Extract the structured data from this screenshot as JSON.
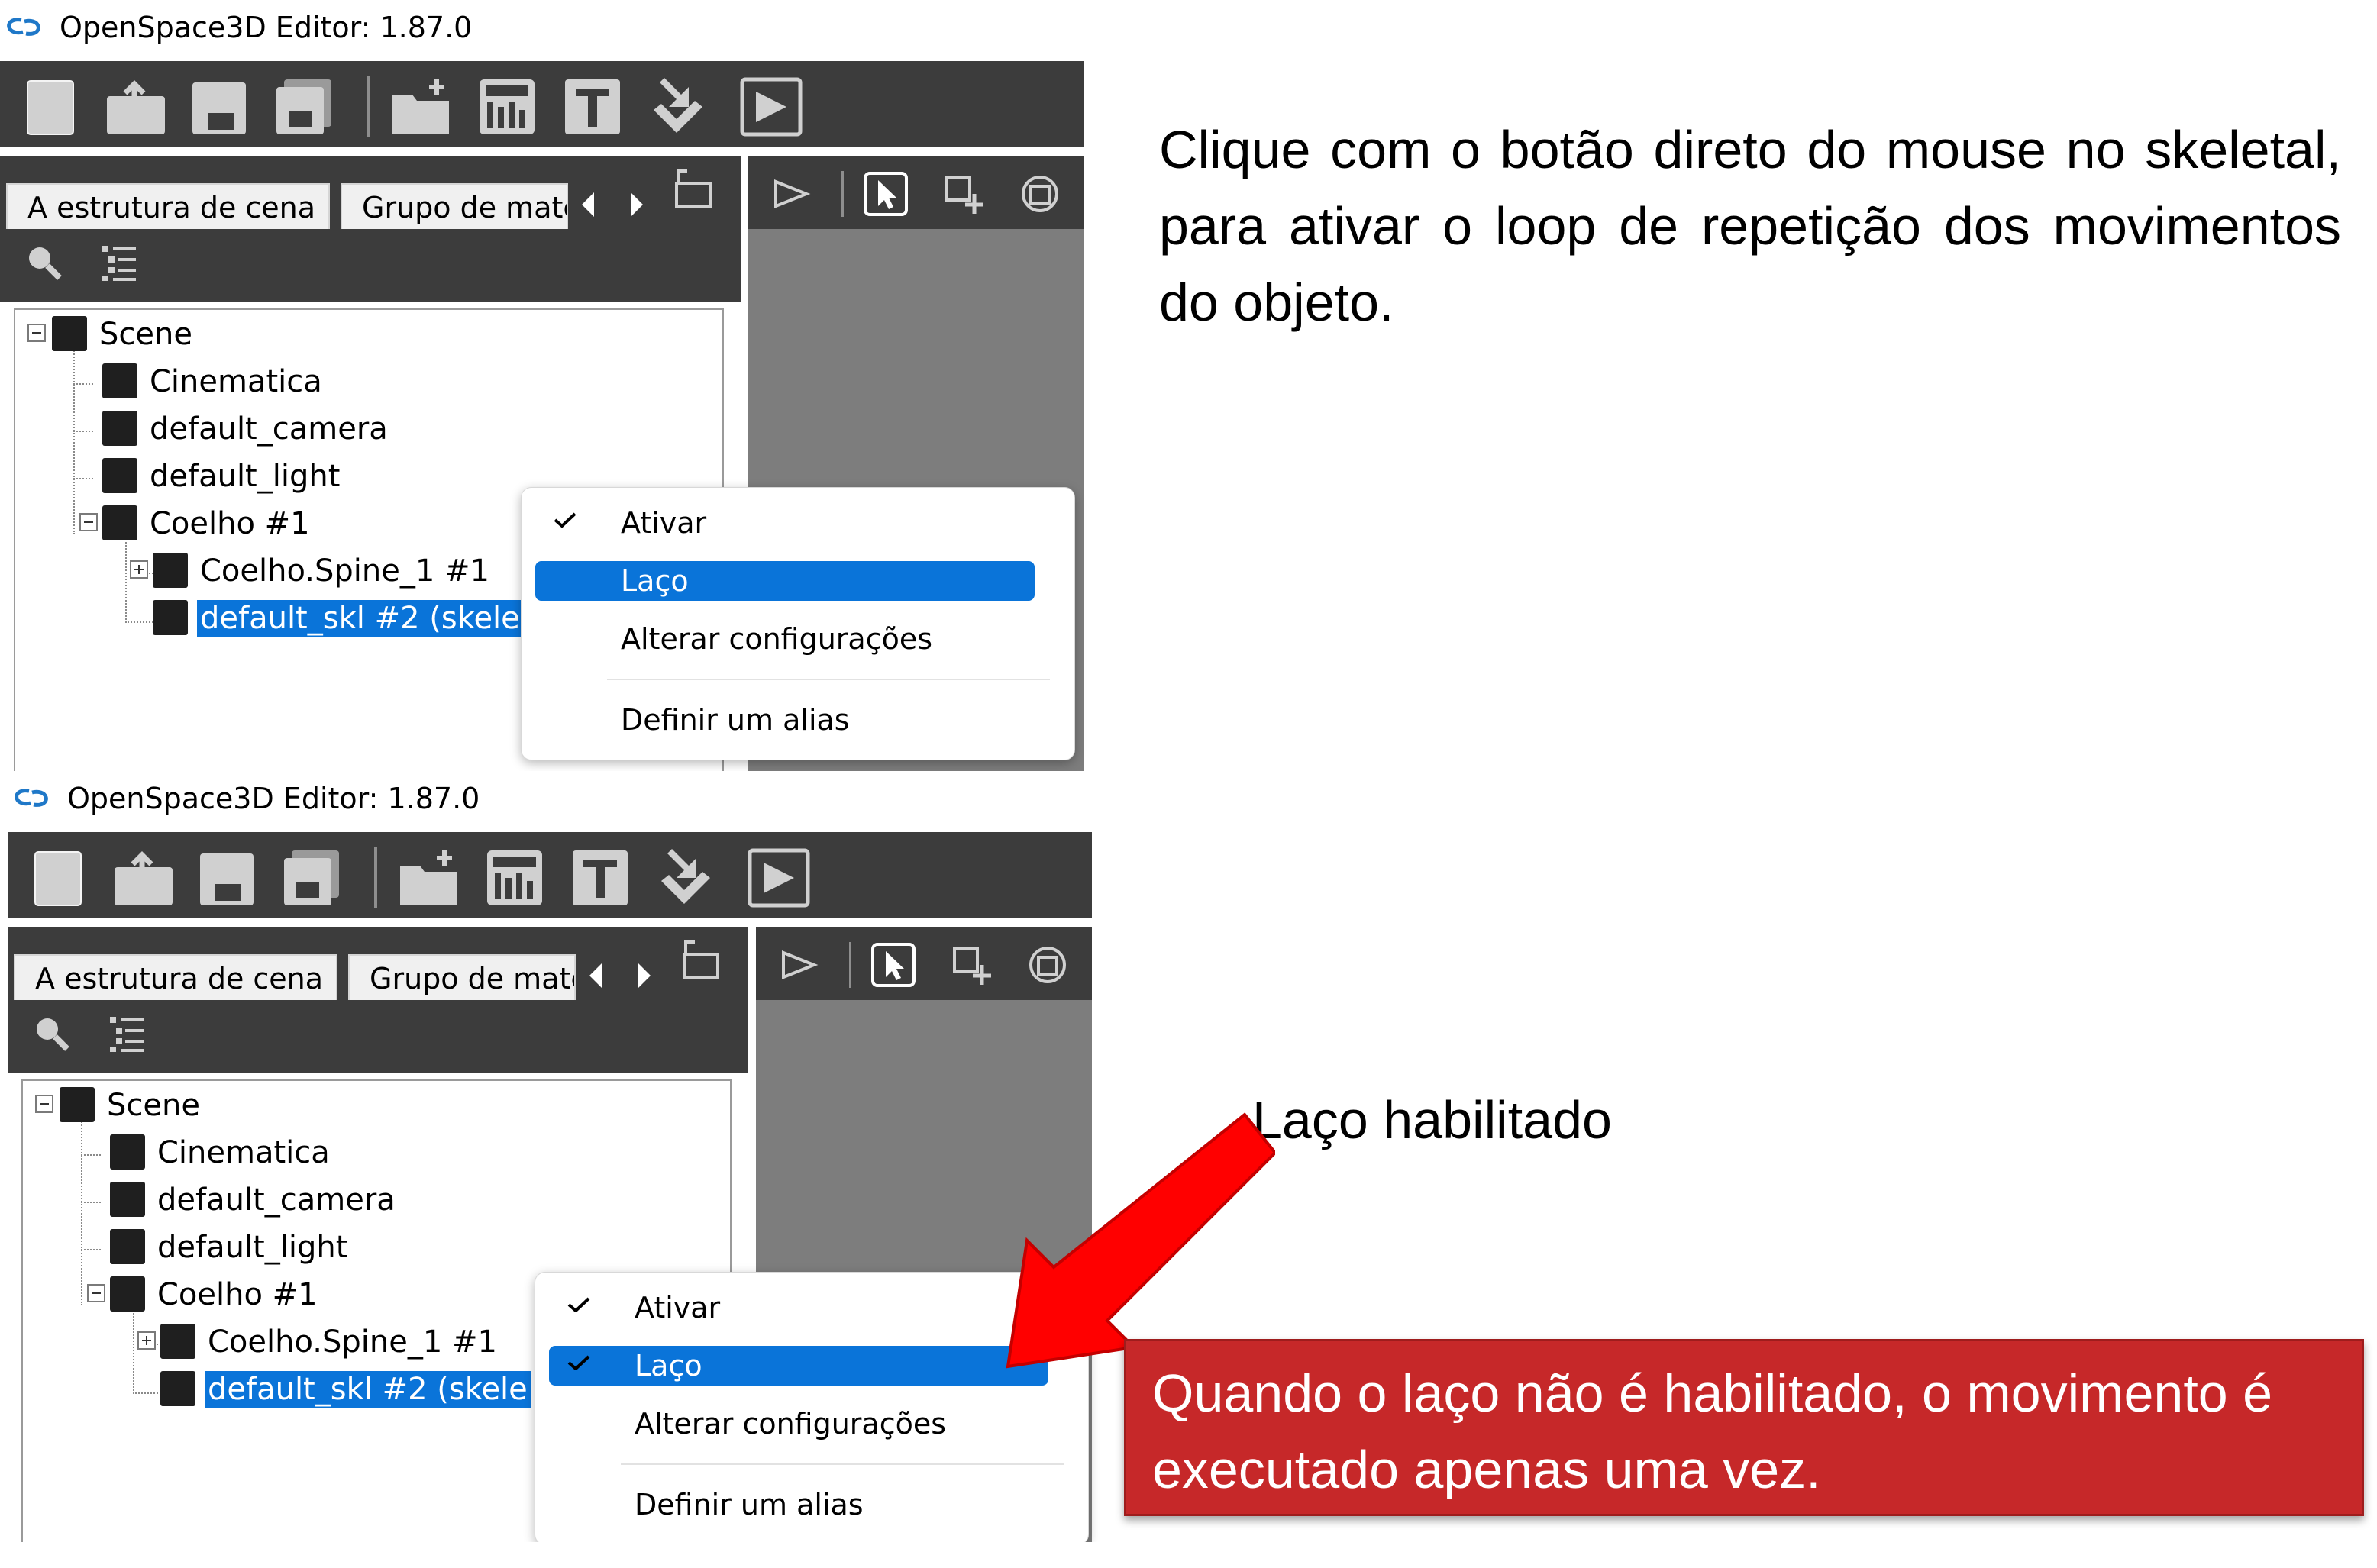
{
  "app": {
    "title": "OpenSpace3D Editor: 1.87.0"
  },
  "toolbar": {
    "icons": [
      "new-file-icon",
      "open-file-icon",
      "save-icon",
      "save-as-icon",
      "add-folder-icon",
      "calculator-icon",
      "text-tool-icon",
      "import-icon",
      "play-icon"
    ]
  },
  "tabs": {
    "scene": "A estrutura de cena",
    "materials": "Grupo de mate"
  },
  "tree": {
    "scene": "Scene",
    "cinematica": "Cinematica",
    "camera": "default_camera",
    "light": "default_light",
    "coelho": "Coelho #1",
    "spine": "Coelho.Spine_1 #1",
    "skeleton": "default_skl #2 (skele"
  },
  "context_menu": {
    "ativar": "Ativar",
    "laco": "Laço",
    "alterar": "Alterar configurações",
    "alias": "Definir um alias"
  },
  "states": {
    "before": {
      "ativar_checked": true,
      "laco_checked": false
    },
    "after": {
      "ativar_checked": true,
      "laco_checked": true
    }
  },
  "instructions": "Clique com o botão direto do mouse no skeletal, para ativar o loop de repetição dos movimentos do objeto.",
  "annotation": {
    "label": "Laço habilitado"
  },
  "note": "Quando o laço não é habilitado, o movimento é executado apenas uma vez.",
  "colors": {
    "selection": "#0a74d9",
    "note_bg": "#c62829",
    "arrow": "#ff0000",
    "toolbar_bg": "#3c3c3c"
  }
}
